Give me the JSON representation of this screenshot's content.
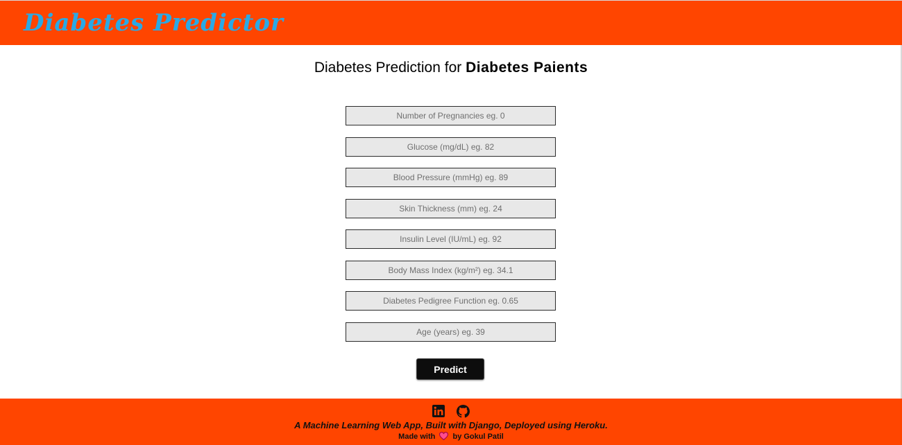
{
  "header": {
    "brand": "Diabetes Predictor"
  },
  "main": {
    "heading_prefix": "Diabetes Prediction for ",
    "heading_strong": "Diabetes Paients",
    "fields": [
      {
        "placeholder": "Number of Pregnancies eg. 0",
        "value": ""
      },
      {
        "placeholder": "Glucose (mg/dL) eg. 82",
        "value": ""
      },
      {
        "placeholder": "Blood Pressure (mmHg) eg. 89",
        "value": ""
      },
      {
        "placeholder": "Skin Thickness (mm) eg. 24",
        "value": ""
      },
      {
        "placeholder": "Insulin Level (IU/mL) eg. 92",
        "value": ""
      },
      {
        "placeholder": "Body Mass Index (kg/m²) eg. 34.1",
        "value": ""
      },
      {
        "placeholder": "Diabetes Pedigree Function eg. 0.65",
        "value": ""
      },
      {
        "placeholder": "Age (years) eg. 39",
        "value": ""
      }
    ],
    "predict_label": "Predict"
  },
  "footer": {
    "icons": [
      "linkedin-icon",
      "github-icon"
    ],
    "tagline": "A Machine Learning Web App, Built with Django, Deployed using Heroku.",
    "credit_prefix": "Made with",
    "credit_heart_icon": "heart-icon",
    "credit_suffix": "by Gokul Patil"
  },
  "colors": {
    "header_bg": "#ff4500",
    "footer_bg": "#ff4500",
    "brand": "#29a9e6",
    "input_bg": "#e8e8e8",
    "button_bg": "#0d0d0d",
    "heart": "#e0245e"
  }
}
